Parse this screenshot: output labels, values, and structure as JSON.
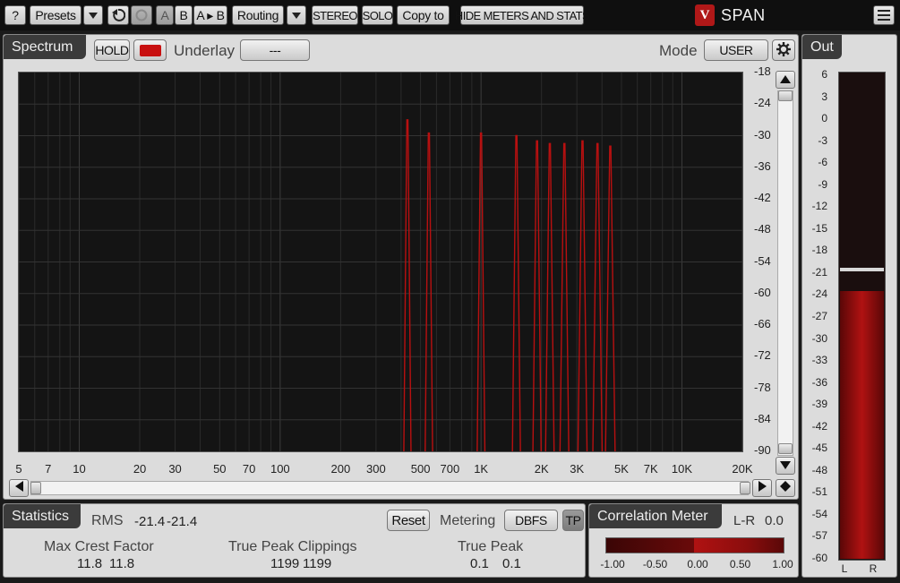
{
  "toolbar": {
    "help": "?",
    "presets": "Presets",
    "ab_a": "A",
    "ab_b": "B",
    "a_to_b": "A ▸ B",
    "routing": "Routing",
    "stereo": "STEREO",
    "solo": "SOLO",
    "copy_to": "Copy to",
    "hide_meters": "HIDE METERS AND STATS",
    "logo_text": "SPAN"
  },
  "spectrum": {
    "tab": "Spectrum",
    "hold": "HOLD",
    "underlay_label": "Underlay",
    "underlay_value": "---",
    "mode_label": "Mode",
    "mode_value": "USER",
    "hold_color": "#c81010",
    "y_labels": [
      "-18",
      "-24",
      "-30",
      "-36",
      "-42",
      "-48",
      "-54",
      "-60",
      "-66",
      "-72",
      "-78",
      "-84",
      "-90"
    ],
    "x_labels": [
      "5",
      "7",
      "10",
      "20",
      "30",
      "50",
      "70",
      "100",
      "200",
      "300",
      "500",
      "700",
      "1K",
      "2K",
      "3K",
      "5K",
      "7K",
      "10K",
      "20K"
    ]
  },
  "statistics": {
    "tab": "Statistics",
    "rms_label": "RMS",
    "rms_l": "-21.4",
    "rms_r": "-21.4",
    "reset": "Reset",
    "metering_label": "Metering",
    "metering_value": "DBFS",
    "tp": "TP",
    "crest_label": "Max Crest Factor",
    "crest_l": "11.8",
    "crest_r": "11.8",
    "clip_label": "True Peak Clippings",
    "clip_l": "1199",
    "clip_r": "1199",
    "tpeak_label": "True Peak",
    "tpeak_l": "0.1",
    "tpeak_r": "0.1"
  },
  "correlation": {
    "tab": "Correlation Meter",
    "mode": "L-R",
    "value": "0.0",
    "scale": [
      "-1.00",
      "-0.50",
      "0.00",
      "0.50",
      "1.00"
    ]
  },
  "out": {
    "tab": "Out",
    "scale": [
      "6",
      "3",
      "0",
      "-3",
      "-6",
      "-9",
      "-12",
      "-15",
      "-18",
      "-21",
      "-24",
      "-27",
      "-30",
      "-33",
      "-36",
      "-39",
      "-42",
      "-45",
      "-48",
      "-51",
      "-54",
      "-57",
      "-60"
    ],
    "left": "L",
    "right": "R",
    "level_db": -23.5,
    "peak_hold_db": -20.5
  },
  "chart_data": {
    "type": "line",
    "title": "",
    "xlabel": "",
    "ylabel": "",
    "x_scale": "log",
    "xlim": [
      5,
      20000
    ],
    "ylim": [
      -90,
      -18
    ],
    "series": [
      {
        "x": [
          430,
          550,
          1000,
          1500,
          1900,
          2200,
          2600,
          3200,
          3800,
          4400
        ],
        "values": [
          -27,
          -29.5,
          -29.5,
          -30,
          -31,
          -31.5,
          -31.5,
          -31,
          -31.5,
          -32
        ],
        "color": "#b81010"
      }
    ]
  }
}
